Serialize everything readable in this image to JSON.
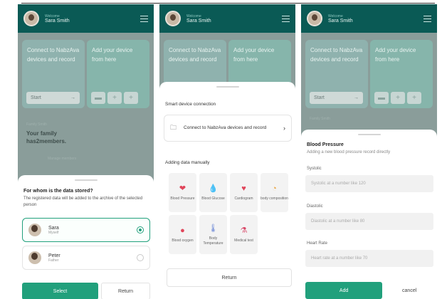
{
  "header": {
    "welcome": "Welcome",
    "user_name": "Sara Smith"
  },
  "home": {
    "connect_card": "Connect to NabzAva devices and record",
    "start_label": "Start",
    "add_device_card": "Add your device from here",
    "family_label": "Family Smith",
    "family_title": "Your family has2members.",
    "manage_members": "Manage members"
  },
  "screen1": {
    "title": "For whom is the data stored?",
    "description": "The registered data will be added to the archive of the selected person",
    "persons": [
      {
        "name": "Sara",
        "relation": "Myself",
        "selected": true
      },
      {
        "name": "Peter",
        "relation": "Father",
        "selected": false
      }
    ],
    "select_label": "Select",
    "return_label": "Return"
  },
  "screen2": {
    "section1_title": "Smart device connection",
    "connect_text": "Connect to NabzAva devices and record",
    "section2_title": "Adding data manually",
    "tiles": [
      {
        "icon": "heart-drop-icon",
        "label": "Blood Pressure"
      },
      {
        "icon": "drop-icon",
        "label": "Blood Glucose"
      },
      {
        "icon": "heart-pulse-icon",
        "label": "Cardiogram"
      },
      {
        "icon": "gauge-icon",
        "label": "body composition"
      },
      {
        "icon": "oxygen-drop-icon",
        "label": "Blood oxygen"
      },
      {
        "icon": "thermometer-icon",
        "label": "Body Temperature"
      },
      {
        "icon": "flask-icon",
        "label": "Medical test"
      }
    ],
    "return_label": "Return"
  },
  "screen3": {
    "title": "Blood Pressure",
    "subtitle": "Adding a new blood pressure record directly",
    "fields": [
      {
        "label": "Systolic",
        "placeholder": "Systolic at a number like 120"
      },
      {
        "label": "Diastolic",
        "placeholder": "Diastolic at a number like 80"
      },
      {
        "label": "Heart Rate",
        "placeholder": "Heart rate at a number like 70"
      }
    ],
    "add_label": "Add",
    "cancel_label": "cancel"
  },
  "colors": {
    "brand": "#0a5a55",
    "accent": "#21a07c",
    "sheet": "#ffffff"
  }
}
